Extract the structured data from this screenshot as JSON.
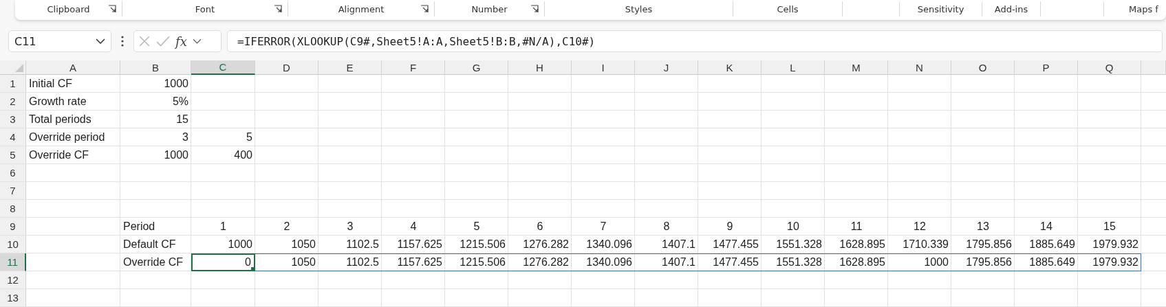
{
  "ribbon": {
    "groups": [
      {
        "label": "Clipboard",
        "launcher": true
      },
      {
        "label": "Font",
        "launcher": true
      },
      {
        "label": "Alignment",
        "launcher": true
      },
      {
        "label": "Number",
        "launcher": true
      },
      {
        "label": "Styles",
        "launcher": false
      },
      {
        "label": "Cells",
        "launcher": false
      },
      {
        "label": "Sensitivity",
        "launcher": false
      },
      {
        "label": "Add-ins",
        "launcher": false
      },
      {
        "label": "Maps f",
        "launcher": false
      }
    ]
  },
  "spill_outline": true,
  "formula_bar": {
    "name_box": "C11",
    "function_label": "fx",
    "formula": "=IFERROR(XLOOKUP(C9#,Sheet5!A:A,Sheet5!B:B,#N/A),C10#)"
  },
  "columns": [
    {
      "label": "A",
      "selected": false
    },
    {
      "label": "B",
      "selected": false
    },
    {
      "label": "C",
      "selected": true
    },
    {
      "label": "D",
      "selected": false
    },
    {
      "label": "E",
      "selected": false
    },
    {
      "label": "F",
      "selected": false
    },
    {
      "label": "G",
      "selected": false
    },
    {
      "label": "H",
      "selected": false
    },
    {
      "label": "I",
      "selected": false
    },
    {
      "label": "J",
      "selected": false
    },
    {
      "label": "K",
      "selected": false
    },
    {
      "label": "L",
      "selected": false
    },
    {
      "label": "M",
      "selected": false
    },
    {
      "label": "N",
      "selected": false
    },
    {
      "label": "O",
      "selected": false
    },
    {
      "label": "P",
      "selected": false
    },
    {
      "label": "Q",
      "selected": false
    }
  ],
  "rows": [
    {
      "number": "1",
      "selected": false,
      "cells": [
        {
          "text": "Initial CF",
          "kind": "text"
        },
        {
          "text": "1000",
          "kind": "number"
        }
      ]
    },
    {
      "number": "2",
      "selected": false,
      "cells": [
        {
          "text": "Growth rate",
          "kind": "text"
        },
        {
          "text": "5%",
          "kind": "number"
        }
      ]
    },
    {
      "number": "3",
      "selected": false,
      "cells": [
        {
          "text": "Total periods",
          "kind": "text"
        },
        {
          "text": "15",
          "kind": "number"
        }
      ]
    },
    {
      "number": "4",
      "selected": false,
      "cells": [
        {
          "text": "Override period",
          "kind": "text"
        },
        {
          "text": "3",
          "kind": "number"
        },
        {
          "text": "5",
          "kind": "number"
        }
      ]
    },
    {
      "number": "5",
      "selected": false,
      "cells": [
        {
          "text": "Override CF",
          "kind": "text"
        },
        {
          "text": "1000",
          "kind": "number"
        },
        {
          "text": "400",
          "kind": "number"
        }
      ]
    },
    {
      "number": "6",
      "selected": false
    },
    {
      "number": "7",
      "selected": false
    },
    {
      "number": "8",
      "selected": false
    },
    {
      "number": "9",
      "selected": false,
      "cells": [
        null,
        {
          "text": "Period",
          "kind": "text"
        },
        {
          "text": "1",
          "kind": "center"
        },
        {
          "text": "2",
          "kind": "center"
        },
        {
          "text": "3",
          "kind": "center"
        },
        {
          "text": "4",
          "kind": "center"
        },
        {
          "text": "5",
          "kind": "center"
        },
        {
          "text": "6",
          "kind": "center"
        },
        {
          "text": "7",
          "kind": "center"
        },
        {
          "text": "8",
          "kind": "center"
        },
        {
          "text": "9",
          "kind": "center"
        },
        {
          "text": "10",
          "kind": "center"
        },
        {
          "text": "11",
          "kind": "center"
        },
        {
          "text": "12",
          "kind": "center"
        },
        {
          "text": "13",
          "kind": "center"
        },
        {
          "text": "14",
          "kind": "center"
        },
        {
          "text": "15",
          "kind": "center"
        }
      ]
    },
    {
      "number": "10",
      "selected": false,
      "cells": [
        null,
        {
          "text": "Default CF",
          "kind": "text"
        },
        {
          "text": "1000",
          "kind": "number"
        },
        {
          "text": "1050",
          "kind": "number"
        },
        {
          "text": "1102.5",
          "kind": "number"
        },
        {
          "text": "1157.625",
          "kind": "number"
        },
        {
          "text": "1215.506",
          "kind": "number"
        },
        {
          "text": "1276.282",
          "kind": "number"
        },
        {
          "text": "1340.096",
          "kind": "number"
        },
        {
          "text": "1407.1",
          "kind": "number"
        },
        {
          "text": "1477.455",
          "kind": "number"
        },
        {
          "text": "1551.328",
          "kind": "number"
        },
        {
          "text": "1628.895",
          "kind": "number"
        },
        {
          "text": "1710.339",
          "kind": "number"
        },
        {
          "text": "1795.856",
          "kind": "number"
        },
        {
          "text": "1885.649",
          "kind": "number"
        },
        {
          "text": "1979.932",
          "kind": "number"
        }
      ]
    },
    {
      "number": "11",
      "selected": true,
      "cells": [
        null,
        {
          "text": "Override CF",
          "kind": "text"
        },
        {
          "text": "0",
          "kind": "number",
          "active": true
        },
        {
          "text": "1050",
          "kind": "number"
        },
        {
          "text": "1102.5",
          "kind": "number"
        },
        {
          "text": "1157.625",
          "kind": "number"
        },
        {
          "text": "1215.506",
          "kind": "number"
        },
        {
          "text": "1276.282",
          "kind": "number"
        },
        {
          "text": "1340.096",
          "kind": "number"
        },
        {
          "text": "1407.1",
          "kind": "number"
        },
        {
          "text": "1477.455",
          "kind": "number"
        },
        {
          "text": "1551.328",
          "kind": "number"
        },
        {
          "text": "1628.895",
          "kind": "number"
        },
        {
          "text": "1000",
          "kind": "number"
        },
        {
          "text": "1795.856",
          "kind": "number"
        },
        {
          "text": "1885.649",
          "kind": "number"
        },
        {
          "text": "1979.932",
          "kind": "number"
        }
      ]
    },
    {
      "number": "12",
      "selected": false
    },
    {
      "number": "13",
      "selected": false
    }
  ]
}
